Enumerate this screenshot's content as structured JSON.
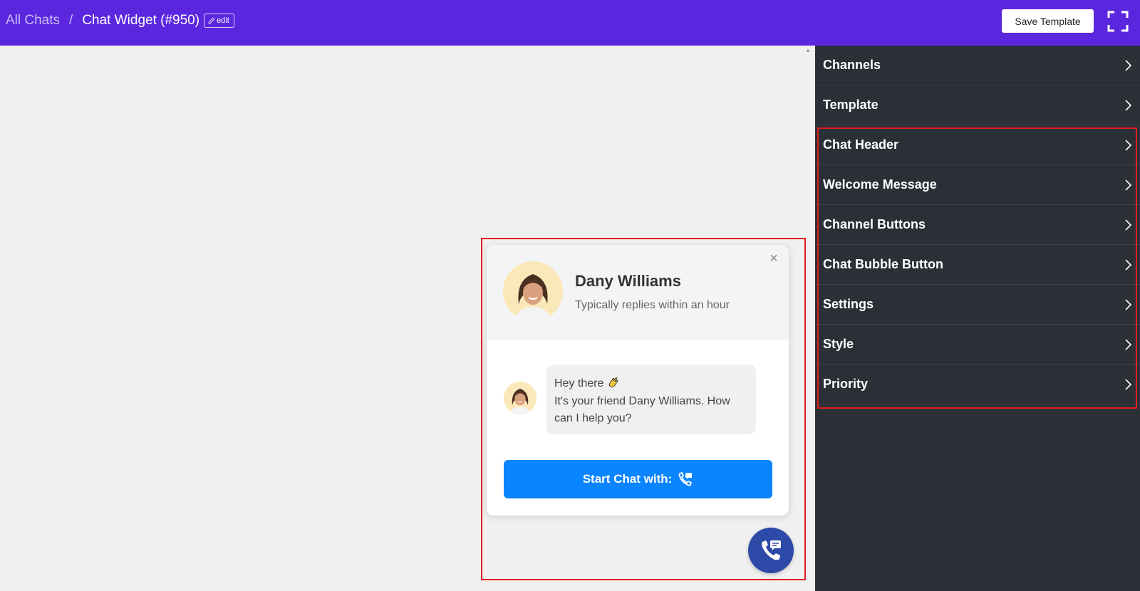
{
  "breadcrumb": {
    "root": "All Chats",
    "separator": "/",
    "current": "Chat Widget (#950)",
    "edit_label": "edit"
  },
  "toolbar": {
    "save_label": "Save Template",
    "fullscreen_icon": "fullscreen-icon"
  },
  "widget": {
    "agent_name": "Dany Williams",
    "agent_status": "Typically replies within an hour",
    "close_icon": "close-icon",
    "message_line1": "Hey there",
    "message_line2": "It's your friend Dany Williams. How can I help you?",
    "start_chat_label": "Start Chat with:",
    "bubble_icon": "phone-chat-icon"
  },
  "sidebar": {
    "items": [
      {
        "label": "Channels"
      },
      {
        "label": "Template"
      },
      {
        "label": "Chat Header"
      },
      {
        "label": "Welcome Message"
      },
      {
        "label": "Channel Buttons"
      },
      {
        "label": "Chat Bubble Button"
      },
      {
        "label": "Settings"
      },
      {
        "label": "Style"
      },
      {
        "label": "Priority"
      }
    ]
  },
  "colors": {
    "topbar": "#5b27de",
    "sidebar": "#2b2f36",
    "start_button": "#0a84ff",
    "chat_bubble_button": "#2d4aa8",
    "highlight": "#e21d1d"
  }
}
